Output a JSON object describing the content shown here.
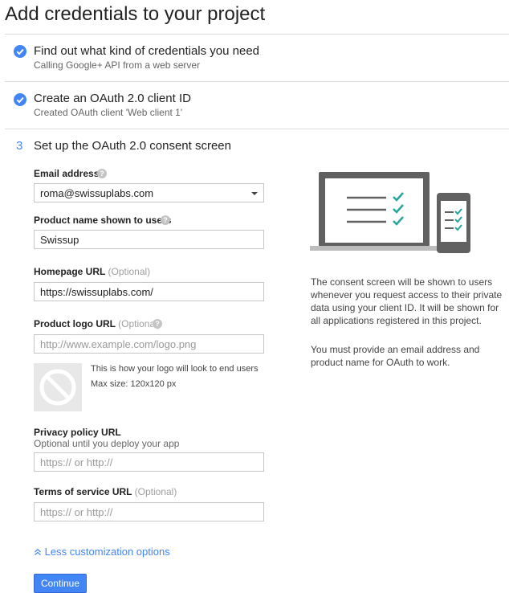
{
  "page_title": "Add credentials to your project",
  "steps": [
    {
      "status": "done",
      "icon": "check-circle-icon",
      "title": "Find out what kind of credentials you need",
      "subtitle": "Calling Google+ API from a web server"
    },
    {
      "status": "done",
      "icon": "check-circle-icon",
      "title": "Create an OAuth 2.0 client ID",
      "subtitle": "Created OAuth client 'Web client 1'"
    },
    {
      "status": "current",
      "number": "3",
      "title": "Set up the OAuth 2.0 consent screen"
    }
  ],
  "form": {
    "email": {
      "label": "Email address",
      "help_icon": "help-icon",
      "value": "roma@swissuplabs.com"
    },
    "product_name": {
      "label": "Product name shown to users",
      "help_icon": "help-icon",
      "value": "Swissup"
    },
    "homepage": {
      "label": "Homepage URL",
      "optional": "(Optional)",
      "value": "https://swissuplabs.com/"
    },
    "logo": {
      "label": "Product logo URL",
      "optional": "(Optional)",
      "help_icon": "help-icon",
      "value": "",
      "placeholder": "http://www.example.com/logo.png",
      "preview_text": "This is how your logo will look to end users",
      "max_size": "Max size: 120x120 px",
      "preview_icon": "no-image-icon"
    },
    "privacy": {
      "label": "Privacy policy URL",
      "hint": "Optional until you deploy your app",
      "value": "",
      "placeholder": "https:// or http://"
    },
    "terms": {
      "label": "Terms of service URL",
      "optional": "(Optional)",
      "value": "",
      "placeholder": "https:// or http://"
    }
  },
  "less_options_label": "Less customization options",
  "continue_label": "Continue",
  "illustration": "laptop-phone-checklist-illustration",
  "info": {
    "paragraph1": "The consent screen will be shown to users whenever you request access to their private data using your client ID. It will be shown for all applications registered in this project.",
    "paragraph2": "You must provide an email address and product name for OAuth to work."
  },
  "colors": {
    "accent": "#4285f4",
    "check_teal": "#26a69a",
    "illustration_gray": "#616161"
  }
}
